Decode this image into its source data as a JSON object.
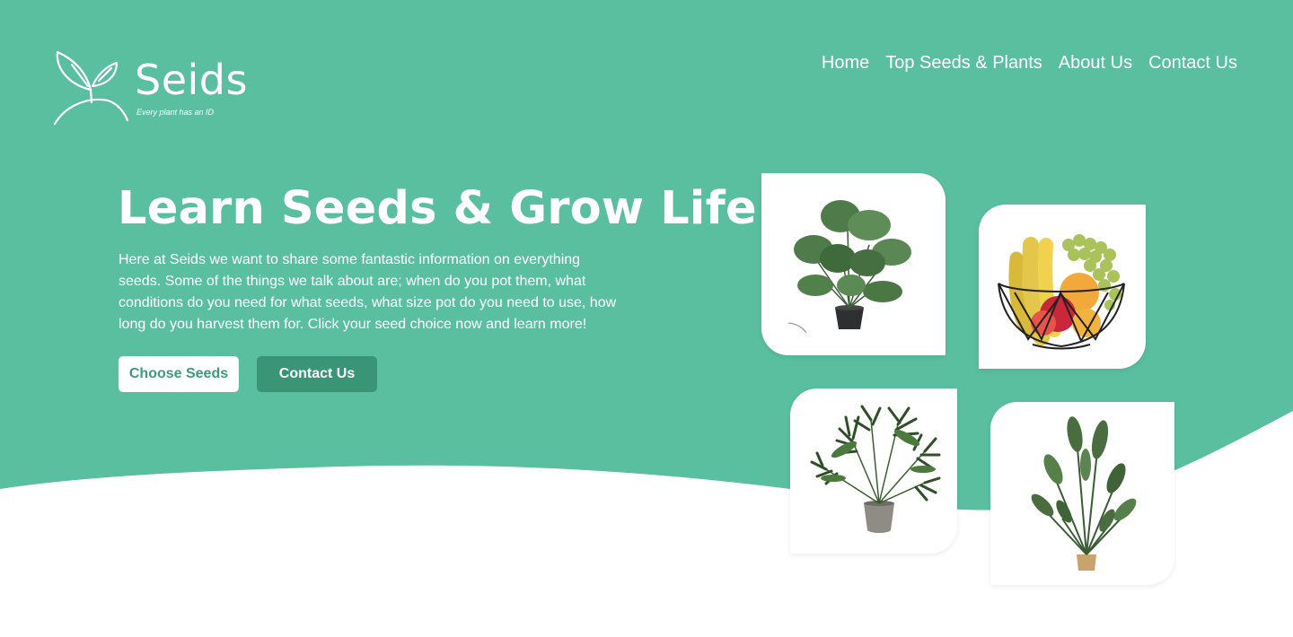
{
  "colors": {
    "brand": "#5abf9f",
    "button_dark": "#3a9577",
    "button_light_text": "#3d9a7c",
    "background": "#ffffff"
  },
  "logo": {
    "name": "Seids",
    "tagline": "Every plant has an ID",
    "icon": "sprout-icon"
  },
  "nav": {
    "items": [
      {
        "label": "Home"
      },
      {
        "label": "Top Seeds & Plants"
      },
      {
        "label": "About Us"
      },
      {
        "label": "Contact Us"
      }
    ]
  },
  "hero": {
    "title": "Learn Seeds & Grow Life",
    "description": "Here at Seids we want to share some fantastic information on everything seeds. Some of the things we talk about are; when do you pot them, what conditions do you need for what seeds, what size pot do you need to use, how long do you harvest them for. Click your seed choice now and learn more!",
    "primary_button": "Choose Seeds",
    "secondary_button": "Contact Us"
  },
  "gallery": {
    "items": [
      {
        "icon": "monstera-plant-image"
      },
      {
        "icon": "fruit-basket-image"
      },
      {
        "icon": "palm-plant-image"
      },
      {
        "icon": "banana-plant-image"
      }
    ]
  }
}
